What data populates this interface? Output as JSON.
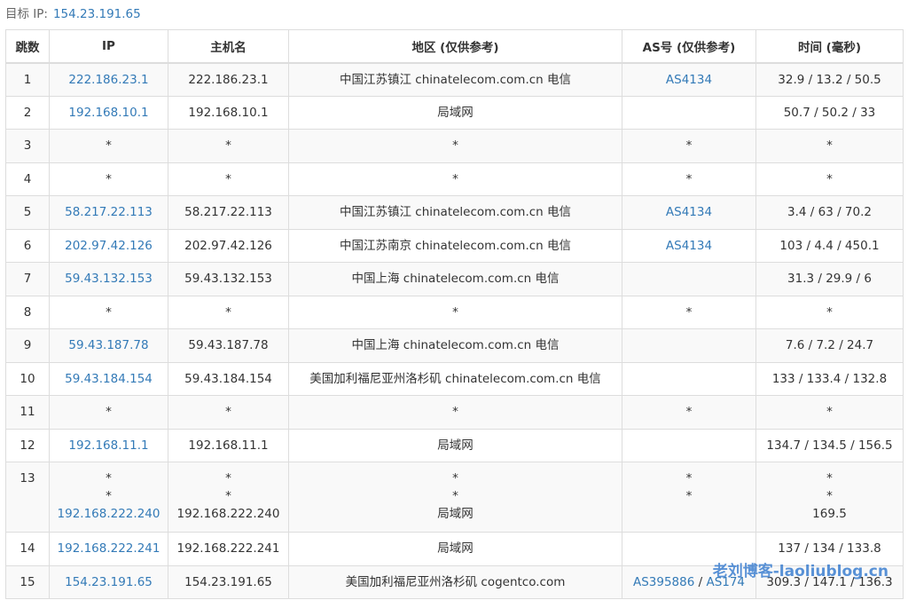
{
  "target": {
    "label": "目标 IP:",
    "ip": "154.23.191.65"
  },
  "table": {
    "headers": [
      "跳数",
      "IP",
      "主机名",
      "地区 (仅供参考)",
      "AS号 (仅供参考)",
      "时间 (毫秒)"
    ],
    "rows": [
      {
        "hop": "1",
        "ips": [
          "222.186.23.1"
        ],
        "hosts": [
          "222.186.23.1"
        ],
        "regions": [
          "中国江苏镇江 chinatelecom.com.cn 电信"
        ],
        "as": [
          "AS4134"
        ],
        "times": [
          "32.9 / 13.2 / 50.5"
        ]
      },
      {
        "hop": "2",
        "ips": [
          "192.168.10.1"
        ],
        "hosts": [
          "192.168.10.1"
        ],
        "regions": [
          "局域网"
        ],
        "as": [],
        "times": [
          "50.7 / 50.2 / 33"
        ]
      },
      {
        "hop": "3",
        "ips": [
          "*"
        ],
        "hosts": [
          "*"
        ],
        "regions": [
          "*"
        ],
        "as": [
          "*"
        ],
        "times": [
          "*"
        ]
      },
      {
        "hop": "4",
        "ips": [
          "*"
        ],
        "hosts": [
          "*"
        ],
        "regions": [
          "*"
        ],
        "as": [
          "*"
        ],
        "times": [
          "*"
        ]
      },
      {
        "hop": "5",
        "ips": [
          "58.217.22.113"
        ],
        "hosts": [
          "58.217.22.113"
        ],
        "regions": [
          "中国江苏镇江 chinatelecom.com.cn 电信"
        ],
        "as": [
          "AS4134"
        ],
        "times": [
          "3.4 / 63 / 70.2"
        ]
      },
      {
        "hop": "6",
        "ips": [
          "202.97.42.126"
        ],
        "hosts": [
          "202.97.42.126"
        ],
        "regions": [
          "中国江苏南京 chinatelecom.com.cn 电信"
        ],
        "as": [
          "AS4134"
        ],
        "times": [
          "103 / 4.4 / 450.1"
        ]
      },
      {
        "hop": "7",
        "ips": [
          "59.43.132.153"
        ],
        "hosts": [
          "59.43.132.153"
        ],
        "regions": [
          "中国上海 chinatelecom.com.cn 电信"
        ],
        "as": [],
        "times": [
          "31.3 / 29.9 / 6"
        ]
      },
      {
        "hop": "8",
        "ips": [
          "*"
        ],
        "hosts": [
          "*"
        ],
        "regions": [
          "*"
        ],
        "as": [
          "*"
        ],
        "times": [
          "*"
        ]
      },
      {
        "hop": "9",
        "ips": [
          "59.43.187.78"
        ],
        "hosts": [
          "59.43.187.78"
        ],
        "regions": [
          "中国上海 chinatelecom.com.cn 电信"
        ],
        "as": [],
        "times": [
          "7.6 / 7.2 / 24.7"
        ]
      },
      {
        "hop": "10",
        "ips": [
          "59.43.184.154"
        ],
        "hosts": [
          "59.43.184.154"
        ],
        "regions": [
          "美国加利福尼亚州洛杉矶 chinatelecom.com.cn 电信"
        ],
        "as": [],
        "times": [
          "133 / 133.4 / 132.8"
        ]
      },
      {
        "hop": "11",
        "ips": [
          "*"
        ],
        "hosts": [
          "*"
        ],
        "regions": [
          "*"
        ],
        "as": [
          "*"
        ],
        "times": [
          "*"
        ]
      },
      {
        "hop": "12",
        "ips": [
          "192.168.11.1"
        ],
        "hosts": [
          "192.168.11.1"
        ],
        "regions": [
          "局域网"
        ],
        "as": [],
        "times": [
          "134.7 / 134.5 / 156.5"
        ]
      },
      {
        "hop": "13",
        "ips": [
          "*",
          "*",
          "192.168.222.240"
        ],
        "hosts": [
          "*",
          "*",
          "192.168.222.240"
        ],
        "regions": [
          "*",
          "*",
          "局域网"
        ],
        "as": [
          "*",
          "*"
        ],
        "times": [
          "*",
          "*",
          "169.5"
        ]
      },
      {
        "hop": "14",
        "ips": [
          "192.168.222.241"
        ],
        "hosts": [
          "192.168.222.241"
        ],
        "regions": [
          "局域网"
        ],
        "as": [],
        "times": [
          "137 / 134 / 133.8"
        ]
      },
      {
        "hop": "15",
        "ips": [
          "154.23.191.65"
        ],
        "hosts": [
          "154.23.191.65"
        ],
        "regions": [
          "美国加利福尼亚州洛杉矶 cogentco.com"
        ],
        "as": [
          "AS395886",
          "AS174"
        ],
        "as_separator": " / ",
        "times": [
          "309.3 / 147.1 / 136.3"
        ]
      }
    ]
  },
  "watermark": "老刘博客-laoliublog.cn",
  "colors": {
    "link": "#337ab7",
    "border": "#dddddd",
    "stripe": "#f9f9f9",
    "watermark": "#3d7fd0"
  }
}
